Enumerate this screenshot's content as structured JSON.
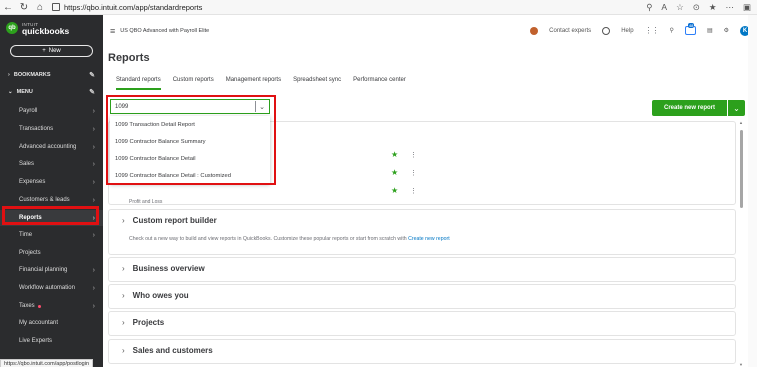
{
  "browser": {
    "url": "https://qbo.intuit.com/app/standardreports"
  },
  "sidebar": {
    "logo_small": "INTUIT",
    "logo_text": "quickbooks",
    "new_button": "New",
    "bookmarks_label": "BOOKMARKS",
    "menu_label": "MENU",
    "items": [
      {
        "label": "Payroll"
      },
      {
        "label": "Transactions"
      },
      {
        "label": "Advanced accounting"
      },
      {
        "label": "Sales"
      },
      {
        "label": "Expenses"
      },
      {
        "label": "Customers & leads"
      },
      {
        "label": "Reports"
      },
      {
        "label": "Time"
      },
      {
        "label": "Projects"
      },
      {
        "label": "Financial planning"
      },
      {
        "label": "Workflow automation"
      },
      {
        "label": "Taxes"
      },
      {
        "label": "My accountant"
      },
      {
        "label": "Live Experts"
      }
    ],
    "status_url": "https://qbo.intuit.com/app/postlogin"
  },
  "header": {
    "company": "US QBO Advanced with Payroll Elite",
    "contact": "Contact experts",
    "help": "Help",
    "badge_count": "48",
    "profile_initial": "K"
  },
  "page": {
    "title": "Reports",
    "tabs": [
      "Standard reports",
      "Custom reports",
      "Management reports",
      "Spreadsheet sync",
      "Performance center"
    ]
  },
  "search": {
    "value": "1099",
    "results": [
      "1099 Transaction Detail Report",
      "1099 Contractor Balance Summary",
      "1099 Contractor Balance Detail",
      "1099 Contractor Balance Detail : Customized"
    ]
  },
  "create_button": "Create new report",
  "favorites_partial_label": "Profit and Loss",
  "sections": [
    {
      "title": "Custom report builder",
      "subtitle": "Check out a new way to build and view reports in QuickBooks. Customize these popular reports or start from scratch with",
      "link": "Create new report"
    },
    {
      "title": "Business overview"
    },
    {
      "title": "Who owes you"
    },
    {
      "title": "Projects"
    },
    {
      "title": "Sales and customers"
    }
  ],
  "colors": {
    "brand_green": "#2ca01c",
    "sidebar_bg": "#2b2c2e",
    "highlight_red": "#e01012",
    "link_blue": "#0077c5"
  }
}
